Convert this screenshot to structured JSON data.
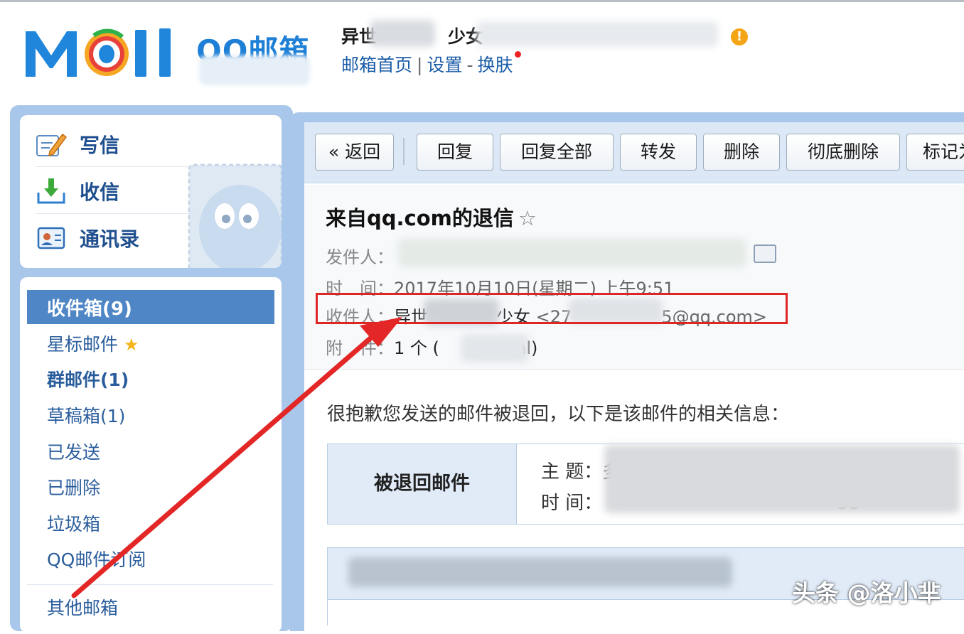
{
  "header": {
    "logo_text": "Mail",
    "logo_sub": "QQ邮箱",
    "user_name": "异世",
    "user_name_suffix": "少女",
    "links": {
      "home": "邮箱首页",
      "settings": "设置",
      "dash": "-",
      "skin": "换肤"
    },
    "warn_symbol": "!"
  },
  "compose": {
    "write": "写信",
    "receive": "收信",
    "contacts": "通讯录"
  },
  "folders": {
    "inbox": "收件箱(9)",
    "starred": "星标邮件",
    "starred_star": "★",
    "group": "群邮件(1)",
    "drafts": "草稿箱(1)",
    "sent": "已发送",
    "deleted": "已删除",
    "spam": "垃圾箱",
    "subscribe": "QQ邮件订阅",
    "other": "其他邮箱"
  },
  "toolbar": {
    "back": "« 返回",
    "reply": "回复",
    "reply_all": "回复全部",
    "forward": "转发",
    "delete": "删除",
    "delete_forever": "彻底删除",
    "mark": "标记为"
  },
  "mail": {
    "subject": "来自qq.com的退信",
    "star": "☆",
    "from_label": "发件人：",
    "time_label": "时　间：",
    "time_value": "2017年10月10日(星期二) 上午9:51",
    "to_label": "收件人：",
    "to_name_a": "异世",
    "to_name_b": "少女",
    "to_email_a": "<27",
    "to_email_b": "5@qq.com>",
    "attach_label": "附　件：",
    "attach_value_a": "1 个 (",
    "attach_value_b": "l.eml)"
  },
  "body": {
    "intro": "很抱歉您发送的邮件被退回，以下是该邮件的相关信息：",
    "table_head": "被退回邮件",
    "subject_label": "主  题：多",
    "time_label": "时  间：",
    "time_tail": "53"
  },
  "watermark": "头条 @洛小芈",
  "colors": {
    "accent_blue": "#1d7fd6",
    "panel_blue": "#a9c7ea",
    "selected_blue": "#4f86c6",
    "highlight_red": "#e02525"
  }
}
